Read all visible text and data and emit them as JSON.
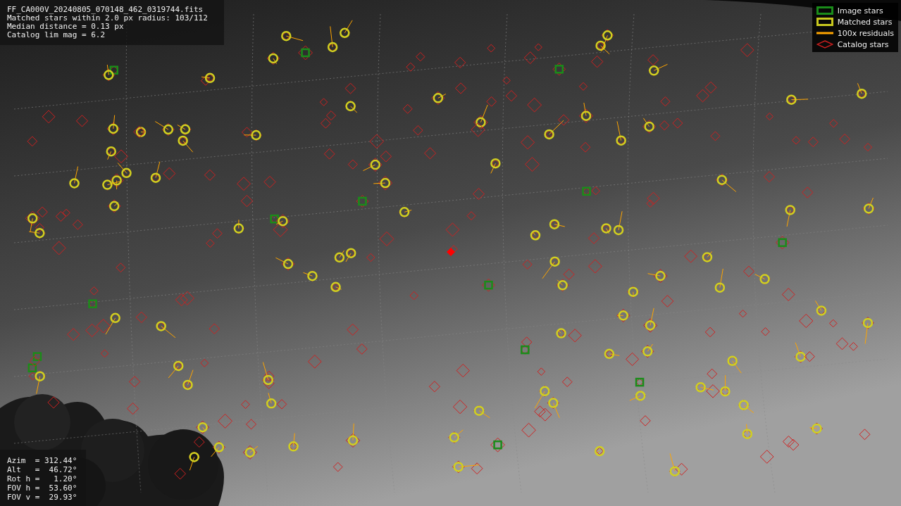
{
  "header": {
    "lines": [
      "FF_CA000V_20240805_070148_462_0319744.fits",
      "Matched stars within 2.0 px radius: 103/112",
      "Median distance = 0.13 px",
      "Catalog lim mag = 6.2"
    ]
  },
  "legend": [
    {
      "label": "Image stars",
      "kind": "box",
      "color": "#1a8c1a"
    },
    {
      "label": "Matched stars",
      "kind": "box",
      "color": "#c8c81e"
    },
    {
      "label": "100x residuals",
      "kind": "line",
      "color": "#ffa500"
    },
    {
      "label": "Catalog stars",
      "kind": "diamond",
      "color": "#c81e1e"
    }
  ],
  "pointing": {
    "lines": [
      "Azim  = 312.44°",
      "Alt   =  46.72°",
      "Rot h =   1.20°",
      "FOV h =  53.60°",
      "FOV v =  29.93°"
    ]
  }
}
